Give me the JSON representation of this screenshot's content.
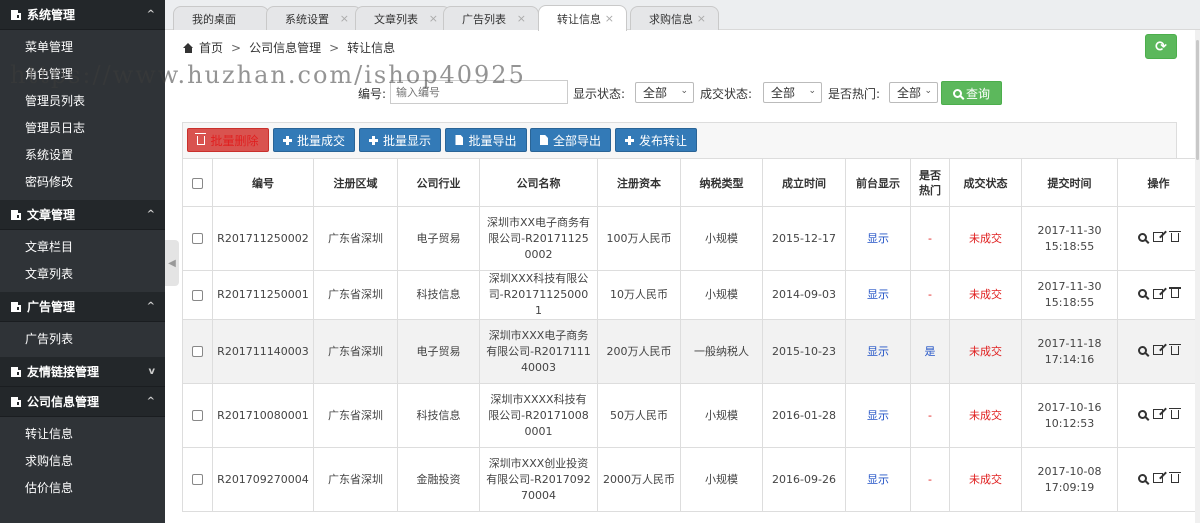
{
  "sidebar": {
    "groups": [
      {
        "label": "系统管理",
        "chev": "^",
        "items": [
          "菜单管理",
          "角色管理",
          "管理员列表",
          "管理员日志",
          "系统设置",
          "密码修改"
        ]
      },
      {
        "label": "文章管理",
        "chev": "^",
        "items": [
          "文章栏目",
          "文章列表"
        ]
      },
      {
        "label": "广告管理",
        "chev": "^",
        "items": [
          "广告列表"
        ]
      },
      {
        "label": "友情链接管理",
        "chev": "v",
        "items": []
      },
      {
        "label": "公司信息管理",
        "chev": "^",
        "items": [
          "转让信息",
          "求购信息",
          "估价信息"
        ]
      }
    ]
  },
  "tabs": [
    {
      "label": "我的桌面",
      "closable": false
    },
    {
      "label": "系统设置",
      "closable": true
    },
    {
      "label": "文章列表",
      "closable": true
    },
    {
      "label": "广告列表",
      "closable": true
    },
    {
      "label": "转让信息",
      "closable": true,
      "active": true
    },
    {
      "label": "求购信息",
      "closable": true
    }
  ],
  "close_glyph": "×",
  "breadcrumb": {
    "home": "首页",
    "sep": ">",
    "level1": "公司信息管理",
    "level2": "转让信息"
  },
  "refresh_glyph": "⟳",
  "watermark": "https://www.huzhan.com/ishop40925",
  "filter": {
    "code_label": "编号:",
    "code_placeholder": "输入编号",
    "display_label": "显示状态:",
    "display_value": "全部",
    "deal_label": "成交状态:",
    "deal_value": "全部",
    "hot_label": "是否热门:",
    "hot_value": "全部",
    "search_label": "查询"
  },
  "actions": {
    "batch_delete": "批量删除",
    "batch_deal": "批量成交",
    "batch_show": "批量显示",
    "batch_export": "批量导出",
    "export_all": "全部导出",
    "publish": "发布转让"
  },
  "table": {
    "headers": [
      "编号",
      "注册区域",
      "公司行业",
      "公司名称",
      "注册资本",
      "纳税类型",
      "成立时间",
      "前台显示",
      "是否热门",
      "成交状态",
      "提交时间",
      "操作"
    ],
    "rows": [
      {
        "code": "R201711250002",
        "region": "广东省深圳",
        "industry": "电子贸易",
        "name": "深圳市XX电子商务有限公司-R201711250002",
        "capital": "100万人民币",
        "tax": "小规模",
        "founded": "2015-12-17",
        "display": "显示",
        "hot": "-",
        "deal": "未成交",
        "submit_date": "2017-11-30",
        "submit_time": "15:18:55"
      },
      {
        "code": "R201711250001",
        "region": "广东省深圳",
        "industry": "科技信息",
        "name": "深圳XXX科技有限公司-R201711250001",
        "capital": "10万人民币",
        "tax": "小规模",
        "founded": "2014-09-03",
        "display": "显示",
        "hot": "-",
        "deal": "未成交",
        "submit_date": "2017-11-30",
        "submit_time": "15:18:55"
      },
      {
        "code": "R201711140003",
        "region": "广东省深圳",
        "industry": "电子贸易",
        "name": "深圳市XXX电子商务有限公司-R201711140003",
        "capital": "200万人民币",
        "tax": "一般纳税人",
        "founded": "2015-10-23",
        "display": "显示",
        "hot": "是",
        "deal": "未成交",
        "submit_date": "2017-11-18",
        "submit_time": "17:14:16"
      },
      {
        "code": "R201710080001",
        "region": "广东省深圳",
        "industry": "科技信息",
        "name": "深圳市XXXX科技有限公司-R201710080001",
        "capital": "50万人民币",
        "tax": "小规模",
        "founded": "2016-01-28",
        "display": "显示",
        "hot": "-",
        "deal": "未成交",
        "submit_date": "2017-10-16",
        "submit_time": "10:12:53"
      },
      {
        "code": "R201709270004",
        "region": "广东省深圳",
        "industry": "金融投资",
        "name": "深圳市XXX创业投资有限公司-R201709270004",
        "capital": "2000万人民币",
        "tax": "小规模",
        "founded": "2016-09-26",
        "display": "显示",
        "hot": "-",
        "deal": "未成交",
        "submit_date": "2017-10-08",
        "submit_time": "17:09:19"
      }
    ]
  }
}
